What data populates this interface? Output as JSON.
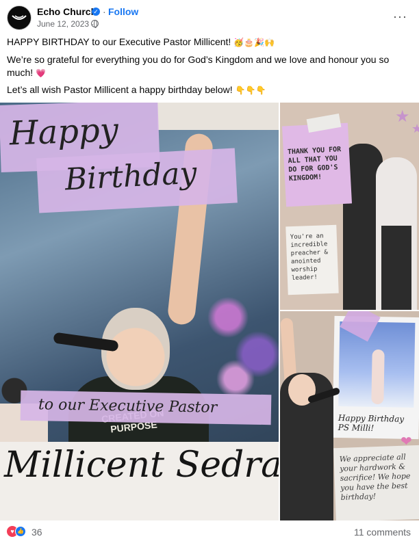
{
  "header": {
    "page_name": "Echo Church",
    "follow_label": "Follow",
    "separator": "·",
    "date": "June 12, 2023 ·",
    "more_label": "···"
  },
  "caption": {
    "line1": "HAPPY BIRTHDAY to our Executive Pastor Millicent!",
    "line1_emoji": "🥳🎂🎉🙌",
    "line2": "We’re so grateful for everything you do for God’s Kingdom and we love and honour you so much!",
    "line2_emoji": "💗",
    "line3": "Let’s all wish Pastor Millicent a happy birthday below!",
    "line3_emoji": "👇👇👇"
  },
  "images": {
    "main": {
      "tape_happy": "Happy",
      "tape_birthday": "Birthday",
      "tape_exec": "to our Executive Pastor",
      "name": "Millicent Sedra:",
      "shirt_text": "CREATED ON PURPOSE"
    },
    "right_top": {
      "note_pink": "THANK YOU FOR ALL THAT YOU DO FOR GOD'S KINGDOM!",
      "note_white": "You're an incredible preacher & anointed worship leader!"
    },
    "right_bottom": {
      "polaroid_caption": "Happy Birthday PS Milli!",
      "note": "We appreciate all your hardwork & sacrifice! We hope you have the best birthday!"
    }
  },
  "footer": {
    "reaction_count": "36",
    "comments_label": "11 comments"
  },
  "colors": {
    "link_blue": "#1877f2",
    "tape_purple": "#d6b5e6",
    "love_red": "#f33e58"
  }
}
